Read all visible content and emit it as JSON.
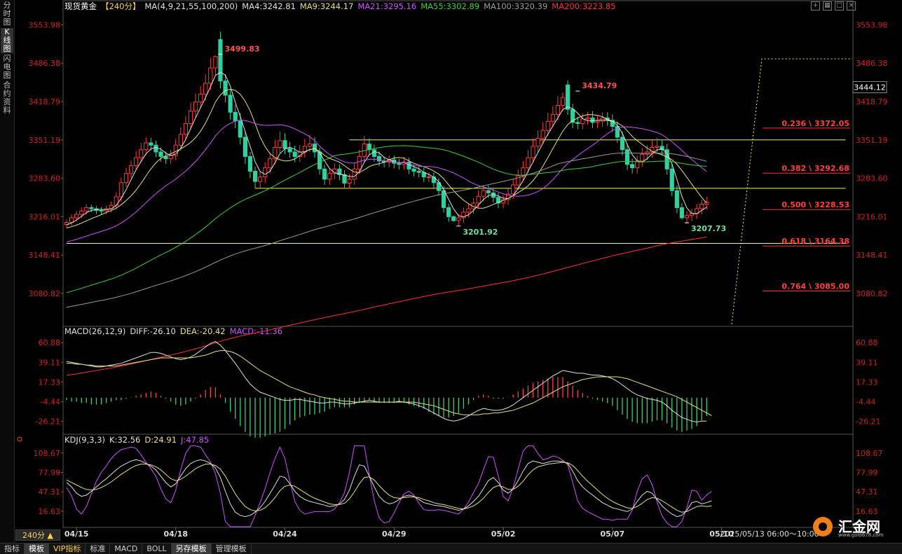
{
  "left_rail": [
    "分时图",
    "K线图",
    "闪电图",
    "合约资料"
  ],
  "left_rail_active": 1,
  "interval_label": "240分 ▲",
  "toolbar_icons": [
    "crosshair-icon",
    "layout-icon",
    "maximize-icon",
    "close-icon"
  ],
  "logo": {
    "text": "汇金网",
    "url": "www.gold678.com"
  },
  "bottom_tabs": [
    "指标",
    "模板",
    "VIP指标",
    "标准",
    "MACD",
    "BOLL",
    "另存模板",
    "管理模板"
  ],
  "bottom_tabs_active": [
    1,
    6
  ],
  "chart_data": [
    {
      "type": "candlestick",
      "panel": "main",
      "legend": [
        {
          "text": "现货黄金",
          "color": "#ffffff"
        },
        {
          "text": "【240分】",
          "color": "#ffd24a"
        },
        {
          "text": "MA(4,9,21,55,100,200)",
          "color": "#e0e0e0"
        },
        {
          "text": "MA4:3242.81",
          "color": "#e0e0e0"
        },
        {
          "text": "MA9:3244.17",
          "color": "#e8e07a"
        },
        {
          "text": "MA21:3295.16",
          "color": "#d050ff"
        },
        {
          "text": "MA55:3302.89",
          "color": "#3ad03a"
        },
        {
          "text": "MA100:3320.39",
          "color": "#9a9a9a"
        },
        {
          "text": "MA200:3223.85",
          "color": "#ff3030"
        }
      ],
      "y_ticks": [
        3553.98,
        3486.38,
        3418.79,
        3351.19,
        3283.6,
        3216.01,
        3148.41,
        3080.82
      ],
      "ylim": [
        3024.0,
        3573.0
      ],
      "current_price": "3444.12",
      "x_ticks": [
        {
          "label": "04/15",
          "i": 2
        },
        {
          "label": "04/18",
          "i": 22
        },
        {
          "label": "04/24",
          "i": 44
        },
        {
          "label": "04/29",
          "i": 66
        },
        {
          "label": "05/02",
          "i": 88
        },
        {
          "label": "05/07",
          "i": 110
        },
        {
          "label": "05/10",
          "i": 132
        }
      ],
      "time_label": "2025/05/13 06:00～10:00",
      "annotations": [
        {
          "text": "3499.83",
          "i": 31,
          "price": 3499.83,
          "color": "#ff5050"
        },
        {
          "text": "3434.79",
          "i": 103,
          "price": 3434.79,
          "color": "#ff5050"
        },
        {
          "text": "3201.92",
          "i": 79,
          "price": 3201.92,
          "color": "#70e0a0"
        },
        {
          "text": "3207.73",
          "i": 125,
          "price": 3207.73,
          "color": "#70e0a0"
        }
      ],
      "horizontal_lines": [
        {
          "price": 3351.19,
          "i_start": 57,
          "i_end": 157
        },
        {
          "price": 3266.0,
          "i_start": 38,
          "i_end": 157
        },
        {
          "price": 3169.0,
          "i_start": 0,
          "i_end": 157
        }
      ],
      "fibonacci": [
        {
          "label": "0.236 \\ 3372.05",
          "price": 3372.05
        },
        {
          "label": "0.382 \\ 3292.68",
          "price": 3292.68
        },
        {
          "label": "0.500 \\ 3228.53",
          "price": 3228.53
        },
        {
          "label": "0.618 \\ 3164.38",
          "price": 3164.38
        },
        {
          "label": "0.764 \\ 3085.00",
          "price": 3085.0
        }
      ],
      "fib_trend_line": {
        "top_price": 3494.0,
        "bottom_price": 3025.0
      },
      "closes": [
        3206,
        3214,
        3220,
        3226,
        3232,
        3230,
        3227,
        3226,
        3230,
        3236,
        3251,
        3276,
        3292,
        3306,
        3320,
        3334,
        3346,
        3342,
        3330,
        3322,
        3318,
        3324,
        3342,
        3361,
        3380,
        3402,
        3418,
        3432,
        3451,
        3478,
        3498,
        3455,
        3430,
        3400,
        3385,
        3356,
        3322,
        3296,
        3278,
        3286,
        3302,
        3318,
        3338,
        3350,
        3336,
        3330,
        3322,
        3330,
        3340,
        3344,
        3330,
        3300,
        3282,
        3292,
        3300,
        3290,
        3275,
        3282,
        3300,
        3322,
        3344,
        3334,
        3322,
        3314,
        3312,
        3316,
        3310,
        3308,
        3312,
        3300,
        3296,
        3294,
        3286,
        3286,
        3276,
        3262,
        3232,
        3216,
        3209,
        3214,
        3224,
        3230,
        3240,
        3252,
        3262,
        3258,
        3250,
        3240,
        3246,
        3256,
        3272,
        3288,
        3302,
        3320,
        3340,
        3354,
        3368,
        3384,
        3396,
        3412,
        3426,
        3405,
        3382,
        3380,
        3388,
        3390,
        3382,
        3384,
        3390,
        3386,
        3375,
        3356,
        3334,
        3308,
        3302,
        3314,
        3326,
        3330,
        3338,
        3340,
        3334,
        3300,
        3262,
        3232,
        3214,
        3218,
        3222,
        3230,
        3238,
        3242
      ],
      "highs_extra": [
        5,
        6,
        6,
        6,
        6,
        5,
        5,
        6,
        6,
        7,
        8,
        9,
        10,
        9,
        11,
        12,
        10,
        9,
        8,
        8,
        9,
        10,
        11,
        12,
        13,
        15,
        15,
        14,
        16,
        18,
        2,
        14,
        12,
        11,
        13,
        14,
        10,
        8,
        8,
        9,
        10,
        11,
        14,
        16,
        13,
        12,
        11,
        12,
        13,
        16,
        12,
        8,
        8,
        9,
        10,
        8,
        8,
        9,
        11,
        12,
        14,
        10,
        9,
        9,
        8,
        8,
        8,
        8,
        9,
        8,
        8,
        8,
        8,
        8,
        8,
        8,
        8,
        7,
        2,
        7,
        8,
        8,
        9,
        10,
        10,
        9,
        8,
        8,
        8,
        9,
        10,
        11,
        12,
        13,
        14,
        14,
        14,
        15,
        15,
        16,
        9,
        8,
        10,
        10,
        10,
        11,
        12,
        10,
        10,
        10,
        10,
        9,
        10,
        11,
        10,
        10,
        11,
        12,
        13,
        14,
        12,
        10,
        9,
        9,
        8,
        8,
        8,
        8,
        8,
        9
      ],
      "lows_extra": [
        6,
        6,
        6,
        6,
        6,
        6,
        6,
        6,
        6,
        6,
        7,
        8,
        8,
        8,
        8,
        9,
        9,
        9,
        9,
        9,
        9,
        9,
        9,
        10,
        10,
        11,
        11,
        11,
        12,
        12,
        13,
        13,
        13,
        13,
        13,
        13,
        13,
        12,
        12,
        11,
        11,
        10,
        10,
        10,
        10,
        10,
        10,
        10,
        10,
        10,
        10,
        10,
        10,
        10,
        10,
        10,
        10,
        10,
        10,
        9,
        9,
        9,
        9,
        9,
        9,
        9,
        9,
        9,
        9,
        9,
        9,
        9,
        9,
        9,
        9,
        9,
        9,
        9,
        2,
        9,
        9,
        9,
        9,
        9,
        9,
        9,
        9,
        9,
        9,
        9,
        9,
        9,
        9,
        9,
        9,
        10,
        10,
        10,
        10,
        10,
        10,
        10,
        10,
        10,
        10,
        10,
        10,
        10,
        10,
        10,
        10,
        10,
        10,
        10,
        10,
        10,
        10,
        10,
        10,
        10,
        10,
        10,
        10,
        10,
        3,
        10,
        10,
        10,
        10,
        10
      ],
      "opens_shift": [
        0,
        0,
        0,
        0,
        0,
        0,
        0,
        0,
        0,
        0,
        0,
        0,
        0,
        0,
        0,
        0,
        0,
        0,
        0,
        0,
        0,
        0,
        0,
        0,
        0,
        0,
        0,
        0,
        0,
        0,
        0,
        30,
        0,
        0,
        0,
        0,
        0,
        0,
        0,
        0,
        0,
        0,
        0,
        0,
        0,
        0,
        0,
        0,
        0,
        0,
        0,
        0,
        0,
        0,
        0,
        0,
        0,
        0,
        0,
        0,
        0,
        0,
        0,
        0,
        0,
        0,
        0,
        0,
        0,
        0,
        0,
        0,
        0,
        0,
        0,
        0,
        0,
        0,
        0,
        0,
        0,
        0,
        0,
        0,
        0,
        0,
        0,
        0,
        0,
        0,
        0,
        0,
        0,
        0,
        0,
        0,
        0,
        0,
        0,
        0,
        0,
        22,
        0,
        0,
        0,
        0,
        0,
        0,
        0,
        0,
        0,
        0,
        0,
        0,
        0,
        0,
        0,
        0,
        0,
        0,
        0,
        0,
        0,
        0,
        0,
        0,
        0,
        0,
        0,
        0,
        0,
        0
      ]
    },
    {
      "type": "line",
      "panel": "macd",
      "legend": [
        {
          "text": "MACD(26,12,9)",
          "color": "#e0e0e0"
        },
        {
          "text": "DIFF:-26.10",
          "color": "#e0e0e0"
        },
        {
          "text": "DEA:-20.42",
          "color": "#e8e07a"
        },
        {
          "text": "MACD:-11.36",
          "color": "#d050ff"
        }
      ],
      "y_ticks": [
        60.88,
        39.11,
        17.33,
        -4.44,
        -26.21
      ],
      "ylim": [
        -39,
        68
      ],
      "diff": [
        40,
        39,
        38,
        37,
        36,
        35,
        34,
        34,
        35,
        36,
        37,
        38,
        40,
        42,
        44,
        46,
        48,
        50,
        50,
        49,
        47,
        45,
        43,
        42,
        43,
        45,
        48,
        52,
        56,
        60,
        62,
        58,
        52,
        45,
        38,
        30,
        22,
        15,
        10,
        6,
        4,
        2,
        0,
        -2,
        -3,
        -3,
        -2,
        -2,
        -3,
        -4,
        -5,
        -6,
        -6,
        -5,
        -5,
        -6,
        -7,
        -7,
        -6,
        -5,
        -4,
        -3,
        -4,
        -5,
        -5,
        -5,
        -5,
        -4,
        -5,
        -6,
        -7,
        -9,
        -11,
        -14,
        -17,
        -20,
        -23,
        -25,
        -26,
        -25,
        -23,
        -20,
        -17,
        -14,
        -12,
        -13,
        -14,
        -14,
        -13,
        -11,
        -8,
        -4,
        0,
        4,
        8,
        12,
        16,
        20,
        24,
        27,
        30,
        29,
        28,
        27,
        27,
        26,
        25,
        25,
        24,
        23,
        21,
        18,
        14,
        10,
        6,
        3,
        1,
        -1,
        -2,
        -3,
        -5,
        -9,
        -14,
        -18,
        -22,
        -24,
        -26,
        -27,
        -26,
        -26
      ],
      "dea": [
        38,
        38,
        37,
        37,
        36,
        36,
        35,
        35,
        35,
        35,
        35,
        36,
        37,
        38,
        39,
        40,
        41,
        42,
        43,
        44,
        44,
        44,
        44,
        44,
        44,
        44,
        45,
        46,
        47,
        49,
        51,
        52,
        52,
        51,
        49,
        46,
        42,
        38,
        34,
        30,
        27,
        24,
        21,
        18,
        15,
        12,
        10,
        8,
        6,
        4,
        3,
        1,
        0,
        -1,
        -2,
        -3,
        -4,
        -4,
        -5,
        -5,
        -5,
        -5,
        -5,
        -5,
        -5,
        -5,
        -5,
        -5,
        -5,
        -5,
        -5,
        -6,
        -7,
        -8,
        -9,
        -11,
        -13,
        -15,
        -17,
        -18,
        -19,
        -19,
        -19,
        -19,
        -18,
        -18,
        -17,
        -17,
        -16,
        -15,
        -14,
        -12,
        -10,
        -8,
        -6,
        -3,
        0,
        3,
        6,
        9,
        12,
        14,
        16,
        18,
        20,
        21,
        22,
        23,
        23,
        23,
        23,
        23,
        22,
        21,
        19,
        17,
        15,
        13,
        11,
        9,
        7,
        5,
        3,
        1,
        -2,
        -5,
        -8,
        -11,
        -14,
        -17,
        -20
      ],
      "hist_scale": 0.8
    },
    {
      "type": "line",
      "panel": "kdj",
      "legend": [
        {
          "text": "KDJ(9,3,3)",
          "color": "#e0e0e0"
        },
        {
          "text": "K:32.56",
          "color": "#e0e0e0"
        },
        {
          "text": "D:24.91",
          "color": "#e8e07a"
        },
        {
          "text": "J:47.85",
          "color": "#d050ff"
        }
      ],
      "y_ticks": [
        108.67,
        77.99,
        47.31,
        16.63
      ],
      "ylim": [
        -8,
        124
      ],
      "k": [
        62,
        55,
        45,
        40,
        42,
        48,
        55,
        62,
        68,
        75,
        82,
        88,
        92,
        96,
        98,
        96,
        92,
        88,
        82,
        72,
        62,
        55,
        60,
        72,
        84,
        92,
        96,
        98,
        96,
        92,
        85,
        70,
        48,
        28,
        15,
        10,
        8,
        10,
        15,
        22,
        32,
        45,
        58,
        72,
        70,
        60,
        48,
        40,
        35,
        32,
        30,
        28,
        26,
        24,
        25,
        28,
        35,
        50,
        72,
        90,
        88,
        72,
        55,
        40,
        32,
        28,
        30,
        35,
        40,
        42,
        40,
        35,
        30,
        28,
        26,
        25,
        24,
        22,
        20,
        18,
        20,
        25,
        32,
        40,
        52,
        65,
        70,
        62,
        50,
        45,
        52,
        65,
        80,
        92,
        96,
        94,
        92,
        94,
        96,
        96,
        95,
        92,
        80,
        65,
        55,
        48,
        42,
        36,
        30,
        26,
        22,
        20,
        18,
        16,
        20,
        32,
        42,
        48,
        45,
        35,
        25,
        18,
        12,
        8,
        10,
        18,
        30,
        32,
        28,
        30,
        33
      ],
      "d": [
        66,
        62,
        58,
        54,
        51,
        50,
        51,
        54,
        58,
        63,
        69,
        75,
        80,
        85,
        89,
        91,
        91,
        90,
        87,
        82,
        75,
        68,
        65,
        67,
        72,
        78,
        84,
        88,
        91,
        91,
        89,
        83,
        72,
        58,
        44,
        33,
        24,
        19,
        17,
        18,
        22,
        29,
        38,
        49,
        56,
        58,
        56,
        51,
        46,
        41,
        37,
        34,
        31,
        28,
        27,
        27,
        29,
        36,
        47,
        60,
        70,
        71,
        66,
        57,
        49,
        42,
        38,
        37,
        38,
        39,
        39,
        38,
        35,
        33,
        30,
        28,
        27,
        25,
        23,
        21,
        20,
        22,
        25,
        30,
        37,
        46,
        54,
        57,
        55,
        51,
        51,
        56,
        64,
        74,
        82,
        87,
        89,
        91,
        92,
        93,
        94,
        93,
        89,
        81,
        72,
        64,
        57,
        50,
        43,
        37,
        32,
        28,
        25,
        22,
        21,
        24,
        29,
        35,
        38,
        37,
        33,
        28,
        23,
        18,
        15,
        16,
        20,
        24,
        25,
        24,
        25
      ],
      "j": [
        54,
        41,
        20,
        12,
        24,
        44,
        64,
        78,
        88,
        100,
        108,
        114,
        116,
        118,
        116,
        106,
        94,
        84,
        72,
        52,
        36,
        30,
        50,
        82,
        108,
        120,
        120,
        118,
        106,
        94,
        76,
        44,
        0,
        -8,
        -8,
        -8,
        -8,
        -8,
        10,
        30,
        52,
        78,
        100,
        118,
        100,
        64,
        32,
        18,
        12,
        14,
        16,
        16,
        16,
        16,
        20,
        30,
        46,
        78,
        120,
        120,
        120,
        74,
        33,
        6,
        -2,
        0,
        14,
        30,
        44,
        48,
        42,
        29,
        19,
        18,
        18,
        19,
        18,
        16,
        14,
        12,
        20,
        31,
        46,
        60,
        82,
        103,
        102,
        72,
        40,
        33,
        54,
        83,
        112,
        120,
        120,
        108,
        98,
        100,
        104,
        102,
        97,
        90,
        62,
        33,
        21,
        16,
        12,
        8,
        4,
        4,
        2,
        4,
        4,
        4,
        18,
        48,
        68,
        74,
        59,
        31,
        9,
        -2,
        -8,
        -8,
        0,
        22,
        50,
        48,
        34,
        42,
        48
      ]
    }
  ]
}
